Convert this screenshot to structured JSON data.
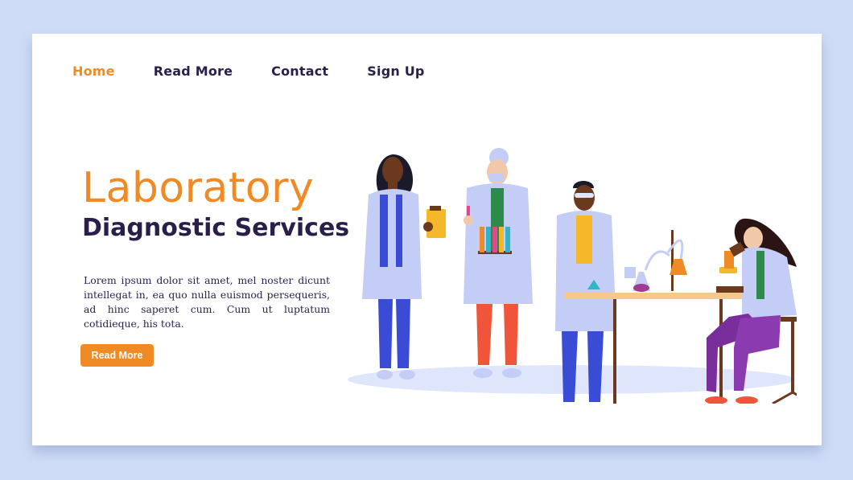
{
  "nav": {
    "items": [
      {
        "label": "Home",
        "active": true
      },
      {
        "label": "Read More",
        "active": false
      },
      {
        "label": "Contact",
        "active": false
      },
      {
        "label": "Sign Up",
        "active": false
      }
    ]
  },
  "hero": {
    "title_line1": "Laboratory",
    "title_line2": "Diagnostic Services",
    "body": "Lorem ipsum dolor sit amet, mel noster dicunt intellegat in, ea quo nulla euismod persequeris, ad hinc saperet cum. Cum ut luptatum cotidieque, his tota.",
    "button_label": "Read More"
  },
  "colors": {
    "accent": "#f08a24",
    "dark_text": "#2a1e4a",
    "background": "#cfdcf8",
    "card": "#ffffff",
    "lab_coat": "#c3cdf5"
  },
  "illustration": {
    "icon": "laboratory-scientists-illustration"
  }
}
